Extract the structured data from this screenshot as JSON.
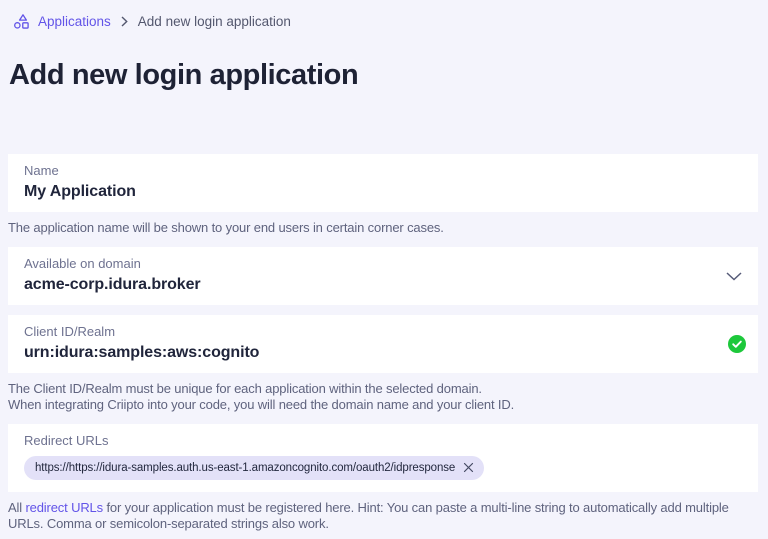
{
  "breadcrumb": {
    "root": "Applications",
    "current": "Add new login application"
  },
  "page": {
    "title": "Add new login application"
  },
  "form": {
    "name": {
      "label": "Name",
      "value": "My Application",
      "helper": "The application name will be shown to your end users in certain corner cases."
    },
    "domain": {
      "label": "Available on domain",
      "value": "acme-corp.idura.broker"
    },
    "client_id": {
      "label": "Client ID/Realm",
      "value": "urn:idura:samples:aws:cognito",
      "helper_line1": "The Client ID/Realm must be unique for each application within the selected domain.",
      "helper_line2": "When integrating Criipto into your code, you will need the domain name and your client ID."
    },
    "redirect_urls": {
      "label": "Redirect URLs",
      "tags": [
        {
          "value": "https://https://idura-samples.auth.us-east-1.amazoncognito.com/oauth2/idpresponse"
        }
      ],
      "helper_prefix": "All ",
      "helper_link": "redirect URLs",
      "helper_suffix": " for your application must be registered here. Hint: You can paste a multi-line string to automatically add multiple URLs. Comma or semicolon-separated strings also work."
    }
  },
  "icons": {
    "breadcrumb_icon": "shapes-icon",
    "separator": "chevron-right-icon",
    "domain_dropdown": "chevron-down-icon",
    "client_id_status": "check-circle-icon",
    "chip_remove": "x-icon"
  },
  "colors": {
    "background": "#f4f4fc",
    "accent_purple": "#6254e8",
    "success_green": "#1dc83b",
    "chip_background": "#e3e1f8"
  }
}
